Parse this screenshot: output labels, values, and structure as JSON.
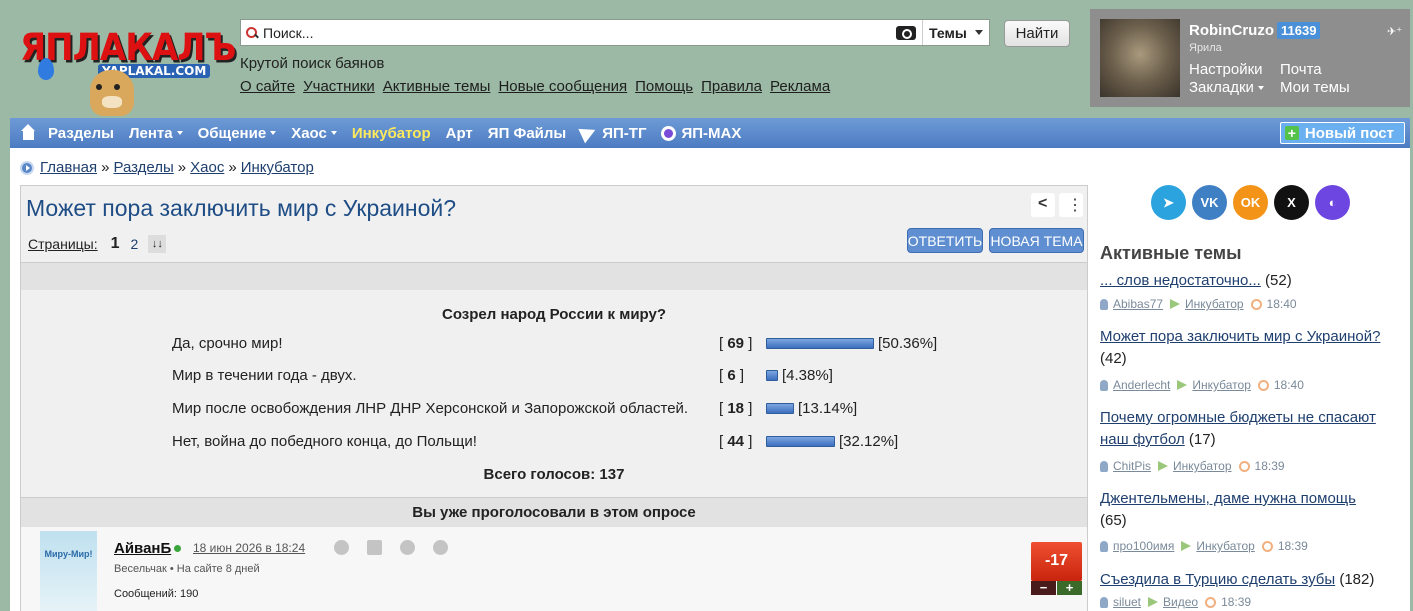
{
  "logo": {
    "text": "ЯПЛАКАЛЪ",
    "subtext": "YAPLAKAL.COM"
  },
  "search": {
    "placeholder": "Поиск...",
    "scope": "Темы",
    "button": "Найти"
  },
  "tagline": "Крутой поиск баянов",
  "top_links": [
    "О сайте",
    "Участники",
    "Активные темы",
    "Новые сообщения",
    "Помощь",
    "Правила",
    "Реклама"
  ],
  "user": {
    "name": "RobinCruzo",
    "count": "11639",
    "role": "Ярила",
    "pin": "✈⁺",
    "links": {
      "settings": "Настройки",
      "mail": "Почта",
      "bookmarks": "Закладки",
      "mytopics": "Мои темы"
    }
  },
  "nav": {
    "items": [
      "Разделы",
      "Лента",
      "Общение",
      "Хаос",
      "Инкубатор",
      "Арт",
      "ЯП Файлы",
      "ЯП-ТГ",
      "ЯП-MAX"
    ],
    "new_post": "Новый пост"
  },
  "breadcrumb": [
    "Главная",
    "Разделы",
    "Хаос",
    "Инкубатор"
  ],
  "breadcrumb_sep": "»",
  "topic": {
    "title": "Может пора заключить мир с Украиной?",
    "pages_label": "Страницы:",
    "pages": [
      "1",
      "2"
    ],
    "sort_icon": "↓↓",
    "reply": "ОТВЕТИТЬ",
    "new_topic": "НОВАЯ ТЕМА"
  },
  "poll": {
    "question": "Созрел народ России к миру?",
    "options": [
      {
        "label": "Да, срочно мир!",
        "count": "69",
        "percent": 50.36,
        "percent_text": "[50.36%]"
      },
      {
        "label": "Мир в течении года - двух.",
        "count": "6",
        "percent": 4.38,
        "percent_text": "[4.38%]"
      },
      {
        "label": "Мир после освобождения ЛНР ДНР Херсонской и Запорожской областей.",
        "count": "18",
        "percent": 13.14,
        "percent_text": "[13.14%]"
      },
      {
        "label": "Нет, война до победного конца, до Польщи!",
        "count": "44",
        "percent": 32.12,
        "percent_text": "[32.12%]"
      }
    ],
    "total": "Всего голосов: 137",
    "voted_msg": "Вы уже проголосовали в этом опросе"
  },
  "post": {
    "avatar_text": "Миру-Мир!",
    "author": "АйванБ",
    "date": "18 июн 2026 в 18:24",
    "meta": "Весельчак  •  На сайте 8 дней",
    "messages": "Сообщений: 190",
    "rating": "-17",
    "minus": "−",
    "plus": "+"
  },
  "social": [
    {
      "name": "telegram",
      "glyph": "➤",
      "color": "#2aa3df"
    },
    {
      "name": "vk",
      "glyph": "VK",
      "color": "#3f7fc4"
    },
    {
      "name": "ok",
      "glyph": "OK",
      "color": "#f39419"
    },
    {
      "name": "x",
      "glyph": "X",
      "color": "#111111"
    },
    {
      "name": "max",
      "glyph": "◐",
      "color": "#6d45e0"
    }
  ],
  "active": {
    "heading": "Активные темы",
    "items": [
      {
        "title": "... слов недостаточно...",
        "count": "(52)",
        "author": "Abibas77",
        "section": "Инкубатор",
        "time": "18:40"
      },
      {
        "title": "Может пора заключить мир с Украиной?",
        "count": "(42)",
        "author": "Anderlecht",
        "section": "Инкубатор",
        "time": "18:40"
      },
      {
        "title": "Почему огромные бюджеты не спасают наш футбол",
        "count": "(17)",
        "author": "ChitPis",
        "section": "Инкубатор",
        "time": "18:39"
      },
      {
        "title": "Джентельмены, даме нужна помощь",
        "count": "(65)",
        "author": "про100имя",
        "section": "Инкубатор",
        "time": "18:39"
      },
      {
        "title": "Съездила в Турцию сделать зубы",
        "count": "(182)",
        "author": "siluet",
        "section": "Видео",
        "time": "18:39"
      }
    ]
  }
}
